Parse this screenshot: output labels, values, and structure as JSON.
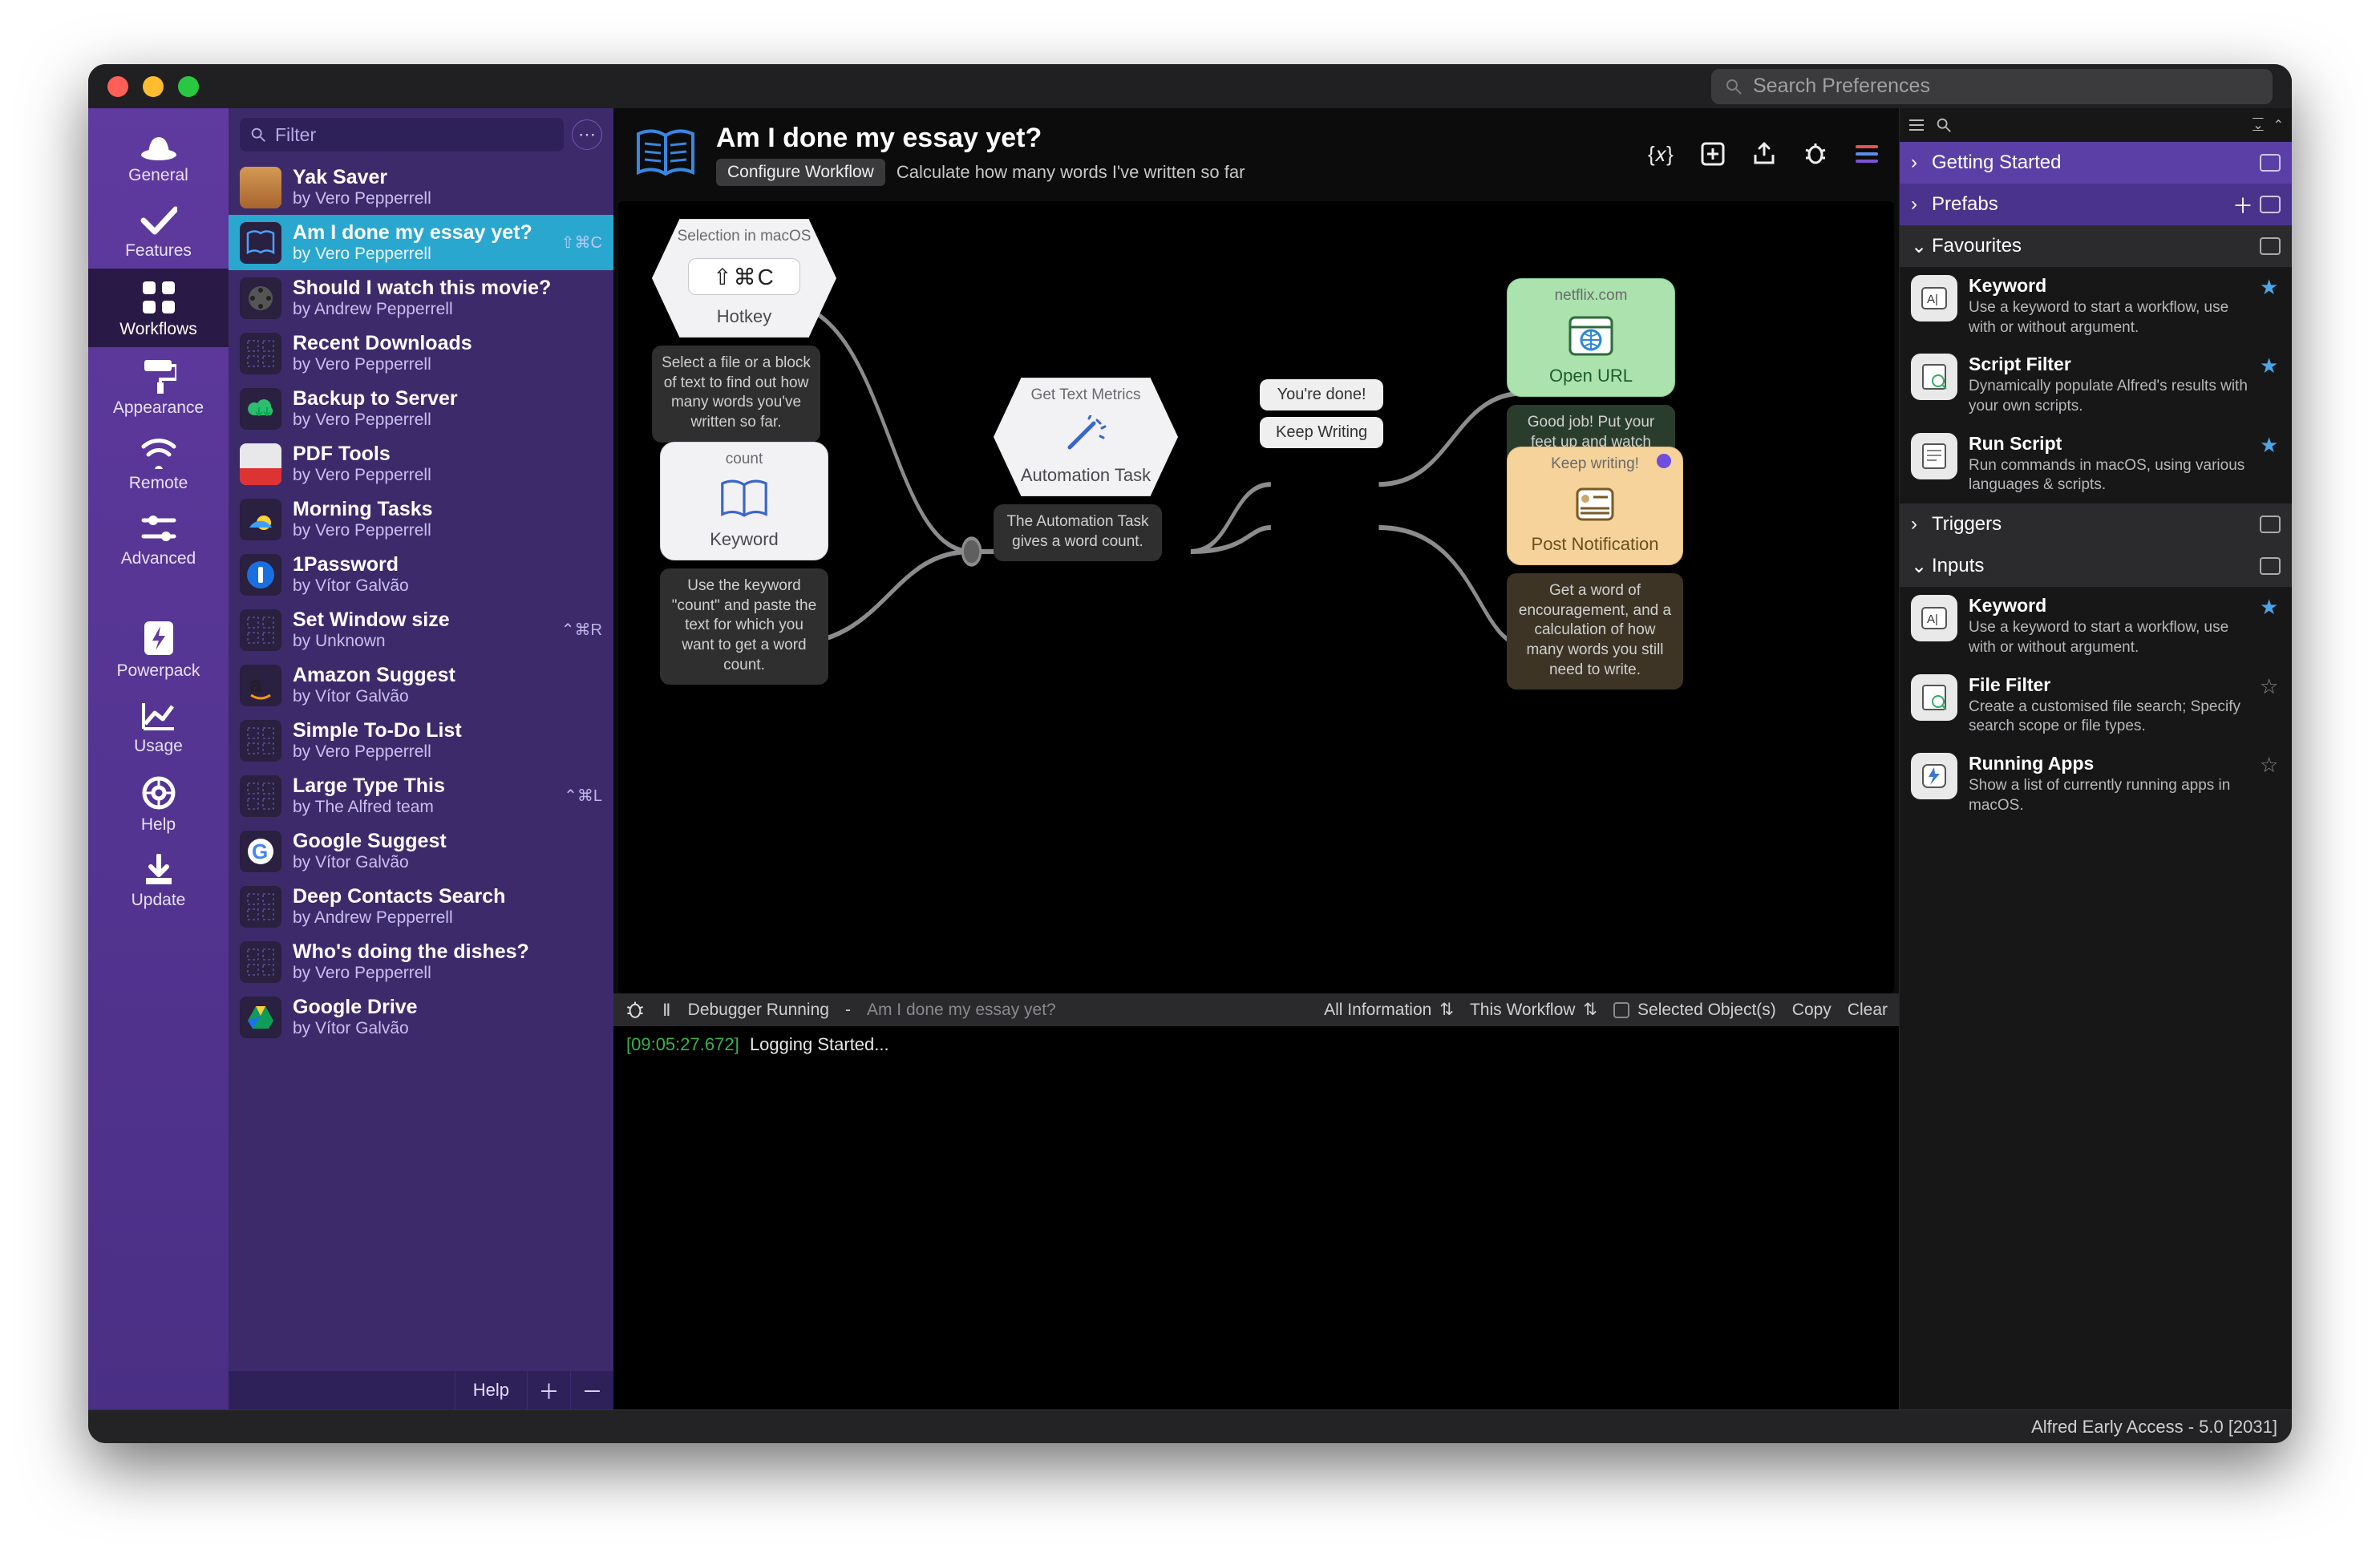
{
  "searchPlaceholder": "Search Preferences",
  "iconbar": [
    {
      "id": "general",
      "label": "General"
    },
    {
      "id": "features",
      "label": "Features"
    },
    {
      "id": "workflows",
      "label": "Workflows"
    },
    {
      "id": "appearance",
      "label": "Appearance"
    },
    {
      "id": "remote",
      "label": "Remote"
    },
    {
      "id": "advanced",
      "label": "Advanced"
    },
    {
      "id": "powerpack",
      "label": "Powerpack"
    },
    {
      "id": "usage",
      "label": "Usage"
    },
    {
      "id": "help",
      "label": "Help"
    },
    {
      "id": "update",
      "label": "Update"
    }
  ],
  "filterPlaceholder": "Filter",
  "workflows": [
    {
      "title": "Yak Saver",
      "author": "by Vero Pepperrell",
      "sc": "",
      "thumb": "yak"
    },
    {
      "title": "Am I done my essay yet?",
      "author": "by Vero Pepperrell",
      "sc": "⇧⌘C",
      "thumb": "book",
      "selected": true
    },
    {
      "title": "Should I watch this movie?",
      "author": "by Andrew Pepperrell",
      "sc": "",
      "thumb": "film"
    },
    {
      "title": "Recent Downloads",
      "author": "by Vero Pepperrell",
      "sc": "",
      "thumb": "plc"
    },
    {
      "title": "Backup to Server",
      "author": "by Vero Pepperrell",
      "sc": "",
      "thumb": "cloud"
    },
    {
      "title": "PDF Tools",
      "author": "by Vero Pepperrell",
      "sc": "",
      "thumb": "pdf"
    },
    {
      "title": "Morning Tasks",
      "author": "by Vero Pepperrell",
      "sc": "",
      "thumb": "sun"
    },
    {
      "title": "1Password",
      "author": "by Vítor Galvão",
      "sc": "",
      "thumb": "onep"
    },
    {
      "title": "Set Window size",
      "author": "by Unknown",
      "sc": "⌃⌘R",
      "thumb": "plc"
    },
    {
      "title": "Amazon Suggest",
      "author": "by Vítor Galvão",
      "sc": "",
      "thumb": "amazon"
    },
    {
      "title": "Simple To-Do List",
      "author": "by Vero Pepperrell",
      "sc": "",
      "thumb": "plc"
    },
    {
      "title": "Large Type This",
      "author": "by The Alfred team",
      "sc": "⌃⌘L",
      "thumb": "plc"
    },
    {
      "title": "Google Suggest",
      "author": "by Vítor Galvão",
      "sc": "",
      "thumb": "google"
    },
    {
      "title": "Deep Contacts Search",
      "author": "by Andrew Pepperrell",
      "sc": "",
      "thumb": "plc"
    },
    {
      "title": "Who's doing the dishes?",
      "author": "by Vero Pepperrell",
      "sc": "",
      "thumb": "plc"
    },
    {
      "title": "Google Drive",
      "author": "by Vítor Galvão",
      "sc": "",
      "thumb": "drive"
    }
  ],
  "wfFooter": {
    "help": "Help"
  },
  "header": {
    "title": "Am I done my essay yet?",
    "configure": "Configure Workflow",
    "description": "Calculate how many words I've written so far"
  },
  "canvas": {
    "hotkey": {
      "pretitle": "Selection in macOS",
      "chip": "⇧⌘C",
      "label": "Hotkey",
      "caption": "Select a file or a block of text to find out how many words you've written so far."
    },
    "keyword": {
      "pretitle": "count",
      "label": "Keyword",
      "caption": "Use the keyword \"count\" and paste the text for which you want to get a word count."
    },
    "task": {
      "pretitle": "Get Text Metrics",
      "label": "Automation Task",
      "caption": "The Automation Task gives a word count."
    },
    "pills": {
      "done": "You're done!",
      "keep": "Keep Writing"
    },
    "openurl": {
      "pretitle": "netflix.com",
      "label": "Open URL",
      "caption": "Good job! Put your feet up and watch some Netflix."
    },
    "notify": {
      "pretitle": "Keep writing!",
      "label": "Post Notification",
      "caption": "Get a word of encouragement, and a calculation of how many words you still need to write."
    }
  },
  "debugger": {
    "status": "Debugger Running",
    "context": "Am I done my essay yet?",
    "infoMode": "All Information",
    "scope": "This Workflow",
    "selected": "Selected Object(s)",
    "copy": "Copy",
    "clear": "Clear",
    "log_ts": "[09:05:27.672]",
    "log_msg": "Logging Started..."
  },
  "palette": {
    "sections": {
      "getting_started": "Getting Started",
      "prefabs": "Prefabs",
      "favourites": "Favourites",
      "triggers": "Triggers",
      "inputs": "Inputs"
    },
    "favourites": [
      {
        "name": "Keyword",
        "desc": "Use a keyword to start a workflow, use with or without argument.",
        "star": true
      },
      {
        "name": "Script Filter",
        "desc": "Dynamically populate Alfred's results with your own scripts.",
        "star": true
      },
      {
        "name": "Run Script",
        "desc": "Run commands in macOS, using various languages & scripts.",
        "star": true
      }
    ],
    "inputs": [
      {
        "name": "Keyword",
        "desc": "Use a keyword to start a workflow, use with or without argument.",
        "star": true
      },
      {
        "name": "File Filter",
        "desc": "Create a customised file search; Specify search scope or file types.",
        "star": false
      },
      {
        "name": "Running Apps",
        "desc": "Show a list of currently running apps in macOS.",
        "star": false
      }
    ]
  },
  "footer": "Alfred Early Access - 5.0 [2031]"
}
